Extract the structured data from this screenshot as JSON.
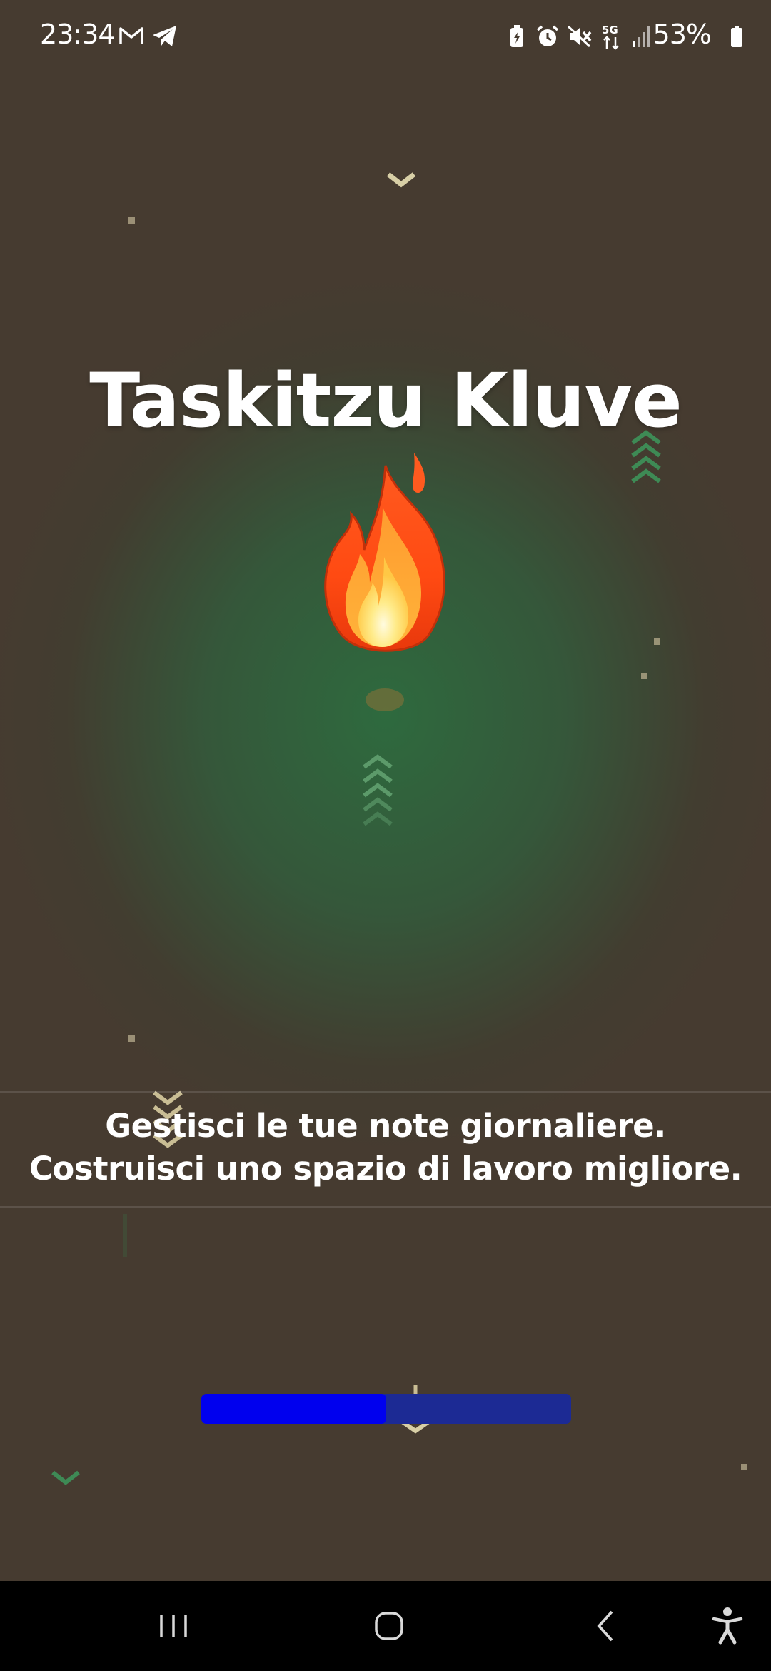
{
  "status_bar": {
    "time": "23:34",
    "battery": "53%",
    "network": "5G",
    "left_icons": [
      "gmail-icon",
      "telegram-icon"
    ],
    "right_icons": [
      "battery-saver-icon",
      "alarm-icon",
      "mute-icon",
      "5g-data-icon",
      "signal-icon",
      "battery-icon"
    ]
  },
  "app": {
    "title": "Taskitzu Kluve",
    "hero_icon": "fire-emoji",
    "tagline_lines": [
      "Gestisci le tue note giornaliere.",
      "Costruisci uno spazio di lavoro migliore."
    ]
  },
  "loading": {
    "progress": 0.5,
    "fill_color": "#0000ee",
    "track_color": "#1c2a94"
  },
  "nav_bar": {
    "buttons": [
      "recent-apps-icon",
      "home-icon",
      "back-icon",
      "accessibility-icon"
    ]
  },
  "colors": {
    "background": "#463b30",
    "center_glow": "#2e6a3e",
    "text": "#ffffff"
  }
}
